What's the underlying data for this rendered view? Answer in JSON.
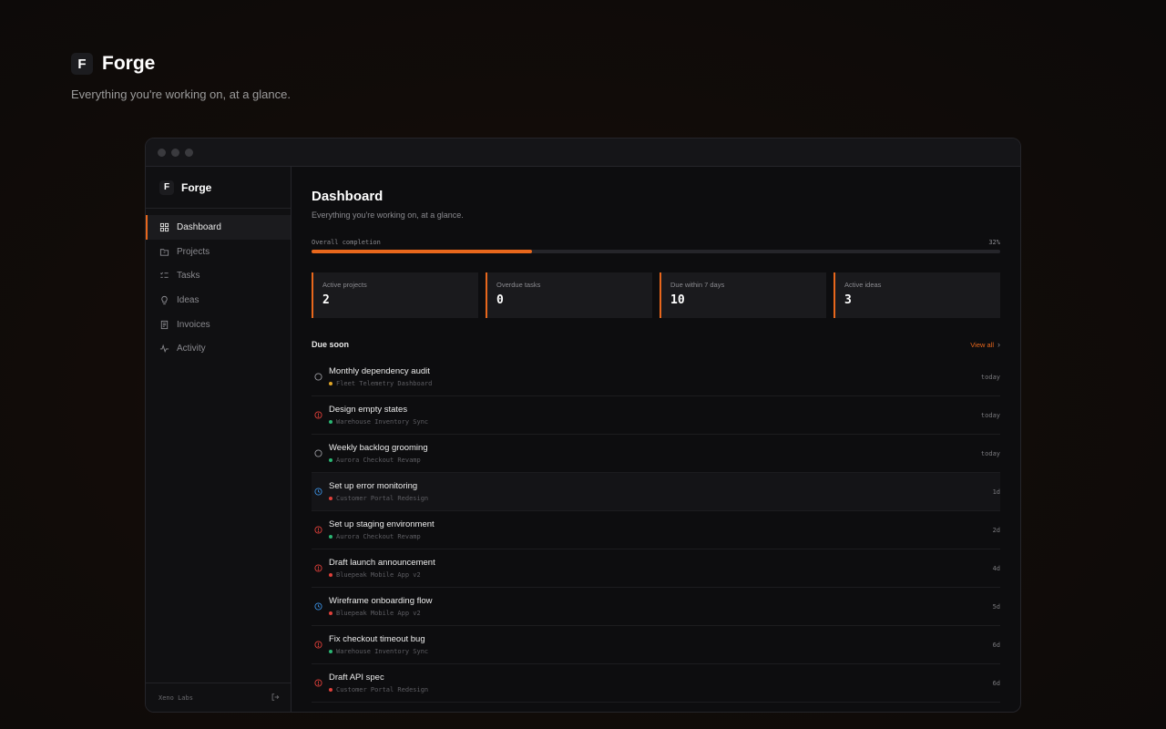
{
  "hero": {
    "logo_letter": "F",
    "title": "Forge",
    "subtitle": "Everything you're working on, at a glance."
  },
  "sidebar": {
    "brand": {
      "logo_letter": "F",
      "name": "Forge"
    },
    "items": [
      {
        "label": "Dashboard",
        "icon": "grid-icon",
        "active": true
      },
      {
        "label": "Projects",
        "icon": "folder-icon",
        "active": false
      },
      {
        "label": "Tasks",
        "icon": "checklist-icon",
        "active": false
      },
      {
        "label": "Ideas",
        "icon": "lightbulb-icon",
        "active": false
      },
      {
        "label": "Invoices",
        "icon": "document-icon",
        "active": false
      },
      {
        "label": "Activity",
        "icon": "pulse-icon",
        "active": false
      }
    ],
    "footer": {
      "org": "Xeno Labs",
      "icon": "logout-icon"
    }
  },
  "main": {
    "title": "Dashboard",
    "subtitle": "Everything you're working on, at a glance.",
    "progress": {
      "label": "Overall completion",
      "value_text": "32%",
      "fraction": 0.32
    },
    "stats": [
      {
        "label": "Active projects",
        "value": "2"
      },
      {
        "label": "Overdue tasks",
        "value": "0"
      },
      {
        "label": "Due within 7 days",
        "value": "10"
      },
      {
        "label": "Active ideas",
        "value": "3"
      }
    ],
    "due_soon": {
      "title": "Due soon",
      "view_all": "View all",
      "tasks": [
        {
          "name": "Monthly dependency audit",
          "project": "Fleet Telemetry Dashboard",
          "project_color": "#e0a526",
          "status": "todo",
          "due": "today"
        },
        {
          "name": "Design empty states",
          "project": "Warehouse Inventory Sync",
          "project_color": "#2bb673",
          "status": "high-priority",
          "due": "today"
        },
        {
          "name": "Weekly backlog grooming",
          "project": "Aurora Checkout Revamp",
          "project_color": "#2bb673",
          "status": "todo",
          "due": "today"
        },
        {
          "name": "Set up error monitoring",
          "project": "Customer Portal Redesign",
          "project_color": "#e0403a",
          "status": "in-progress",
          "due": "1d"
        },
        {
          "name": "Set up staging environment",
          "project": "Aurora Checkout Revamp",
          "project_color": "#2bb673",
          "status": "high-priority",
          "due": "2d"
        },
        {
          "name": "Draft launch announcement",
          "project": "Bluepeak Mobile App v2",
          "project_color": "#e0403a",
          "status": "high-priority",
          "due": "4d"
        },
        {
          "name": "Wireframe onboarding flow",
          "project": "Bluepeak Mobile App v2",
          "project_color": "#e0403a",
          "status": "in-progress",
          "due": "5d"
        },
        {
          "name": "Fix checkout timeout bug",
          "project": "Warehouse Inventory Sync",
          "project_color": "#2bb673",
          "status": "high-priority",
          "due": "6d"
        },
        {
          "name": "Draft API spec",
          "project": "Customer Portal Redesign",
          "project_color": "#e0403a",
          "status": "high-priority",
          "due": "6d"
        }
      ]
    }
  },
  "colors": {
    "accent": "#e8671c",
    "todo": "#9a9aa0",
    "high": "#e0403a",
    "progress": "#3b8fe0"
  }
}
